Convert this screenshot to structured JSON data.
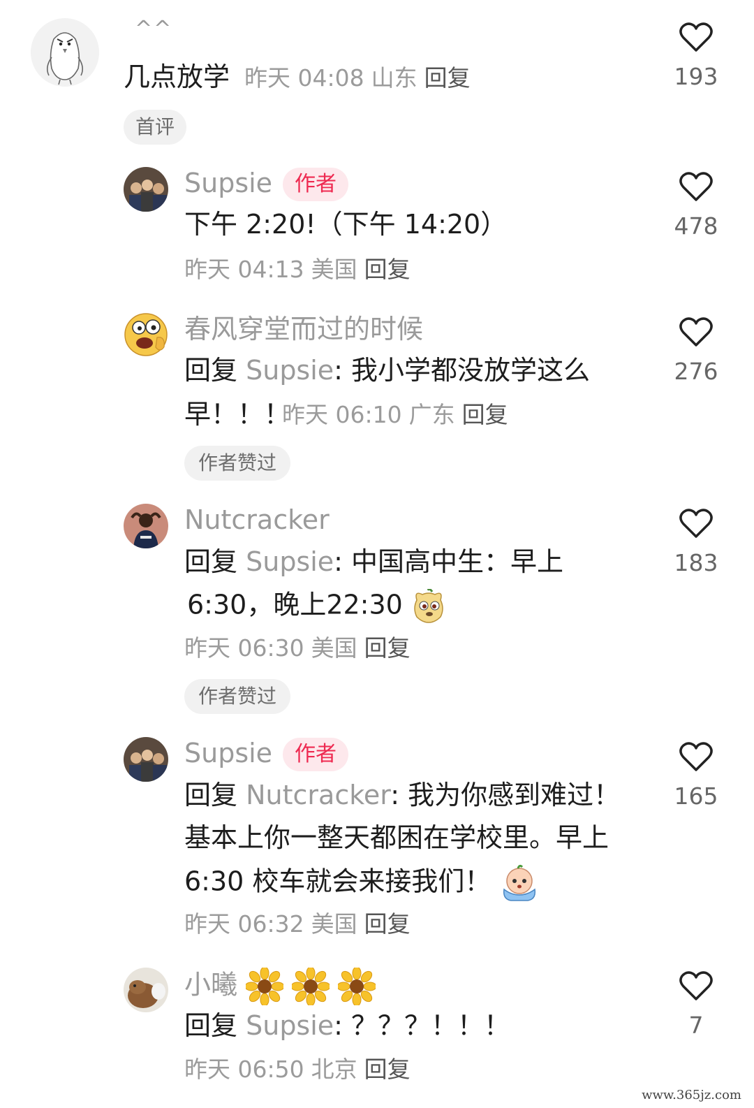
{
  "comments": [
    {
      "carets": "^^",
      "text": "几点放学",
      "time": "昨天 04:08",
      "location": "山东",
      "reply": "回复",
      "badge": "首评",
      "likes": "193"
    },
    {
      "name": "Supsie",
      "author_tag": "作者",
      "text": "下午 2:20!（下午 14:20）",
      "time": "昨天 04:13",
      "location": "美国",
      "reply": "回复",
      "likes": "478"
    },
    {
      "name": "春风穿堂而过的时候",
      "reply_prefix": "回复",
      "reply_to": "Supsie",
      "text_line1": ": 我小学都没放学这么",
      "text_line2": "早！！！",
      "time": "昨天 06:10",
      "location": "广东",
      "reply": "回复",
      "badge": "作者赞过",
      "likes": "276"
    },
    {
      "name": "Nutcracker",
      "reply_prefix": "回复",
      "reply_to": "Supsie",
      "text_line1": ": 中国高中生：早上",
      "text_line2": "6:30，晚上22:30",
      "time": "昨天 06:30",
      "location": "美国",
      "reply": "回复",
      "badge": "作者赞过",
      "likes": "183"
    },
    {
      "name": "Supsie",
      "author_tag": "作者",
      "reply_prefix": "回复",
      "reply_to": "Nutcracker",
      "text_line1": ": 我为你感到难过！",
      "text_line2": "基本上你一整天都困在学校里。早上",
      "text_line3": "6:30 校车就会来接我们！",
      "time": "昨天 06:32",
      "location": "美国",
      "reply": "回复",
      "likes": "165"
    },
    {
      "name": "小曦",
      "reply_prefix": "回复",
      "reply_to": "Supsie",
      "text_line1": ": ？？？！！！",
      "time": "昨天 06:50",
      "location": "北京",
      "reply": "回复",
      "likes": "7"
    }
  ],
  "icons": {
    "like": "heart-outline-icon",
    "sunflower": "sunflower-emoji",
    "surprised": "dog-emoji",
    "crying": "crying-emoji"
  },
  "colors": {
    "author_tag_bg": "#fde8ec",
    "author_tag_text": "#ee2a51",
    "secondary_text": "#9a9a9a"
  },
  "watermark": "www.365jz.com"
}
